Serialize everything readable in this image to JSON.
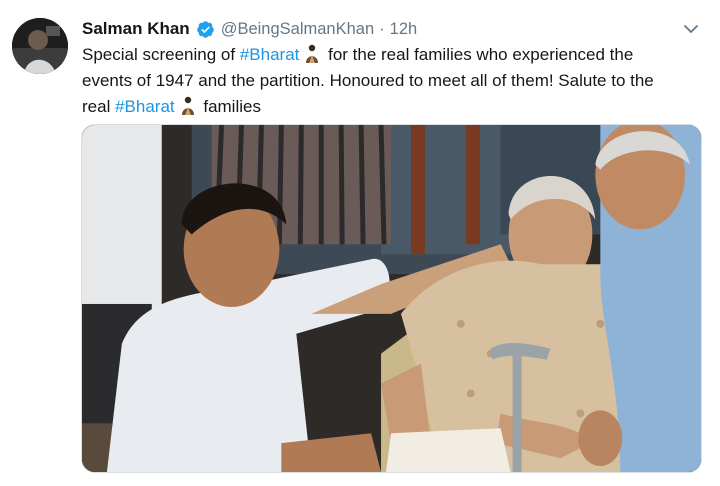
{
  "tweet": {
    "author": {
      "display_name": "Salman Khan",
      "verified_icon": "verified-badge-icon",
      "handle": "@BeingSalmanKhan",
      "separator": "·",
      "time": "12h"
    },
    "text": {
      "line1_a": "Special screening of ",
      "hashtag1": "#Bharat",
      "line1_b": " for the real families who experienced the",
      "line2": "events of 1947 and the partition. Honoured to meet all of them! Salute to the",
      "line3_a": "real ",
      "hashtag2": "#Bharat",
      "line3_b": " families"
    },
    "menu_icon": "chevron-down-icon",
    "media_description_icon": "photo",
    "colors": {
      "link": "#1b95e0",
      "secondary_text": "#657786",
      "verified": "#1da1f2"
    }
  }
}
